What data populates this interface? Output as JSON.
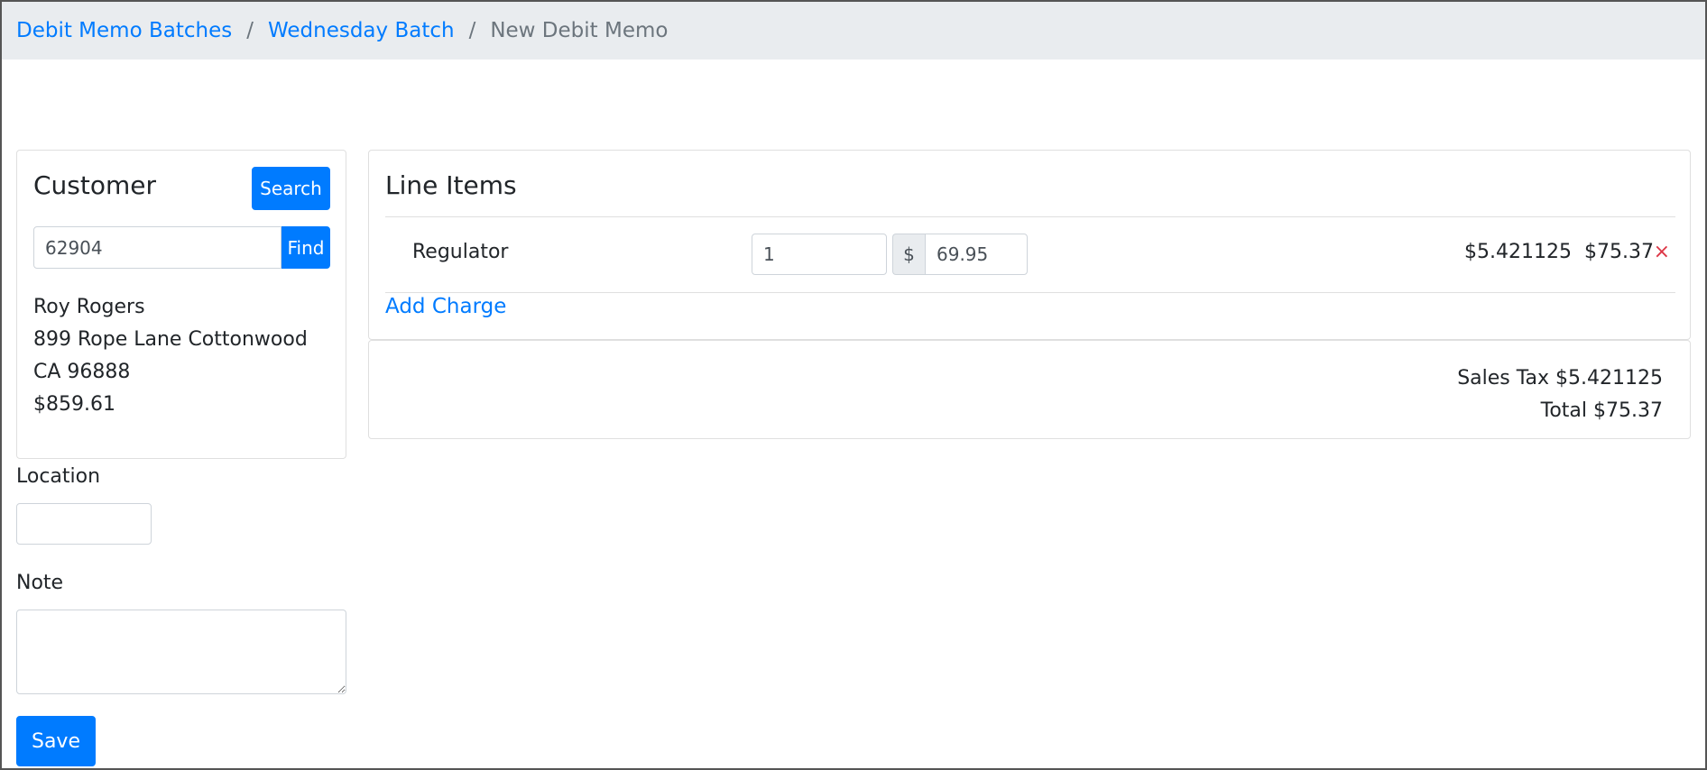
{
  "breadcrumb": {
    "items": [
      "Debit Memo Batches",
      "Wednesday Batch"
    ],
    "current": "New Debit Memo",
    "separator": "/"
  },
  "customer": {
    "title": "Customer",
    "search_label": "Search",
    "find_value": "62904",
    "find_label": "Find",
    "name": "Roy Rogers",
    "address_line1": "899 Rope Lane Cottonwood",
    "address_line2": "CA 96888",
    "balance": "$859.61"
  },
  "location": {
    "label": "Location",
    "value": ""
  },
  "note": {
    "label": "Note",
    "value": ""
  },
  "save_label": "Save",
  "line_items": {
    "title": "Line Items",
    "items": [
      {
        "name": "Regulator",
        "quantity": "1",
        "currency": "$",
        "price": "69.95",
        "tax": "$5.421125",
        "total": "$75.37",
        "remove_glyph": "×"
      }
    ],
    "add_charge_label": "Add Charge"
  },
  "totals": {
    "sales_tax": "Sales Tax $5.421125",
    "total": "Total $75.37"
  },
  "colors": {
    "primary": "#007bff",
    "danger": "#dc3545",
    "breadcrumb_bg": "#e9ecef"
  }
}
